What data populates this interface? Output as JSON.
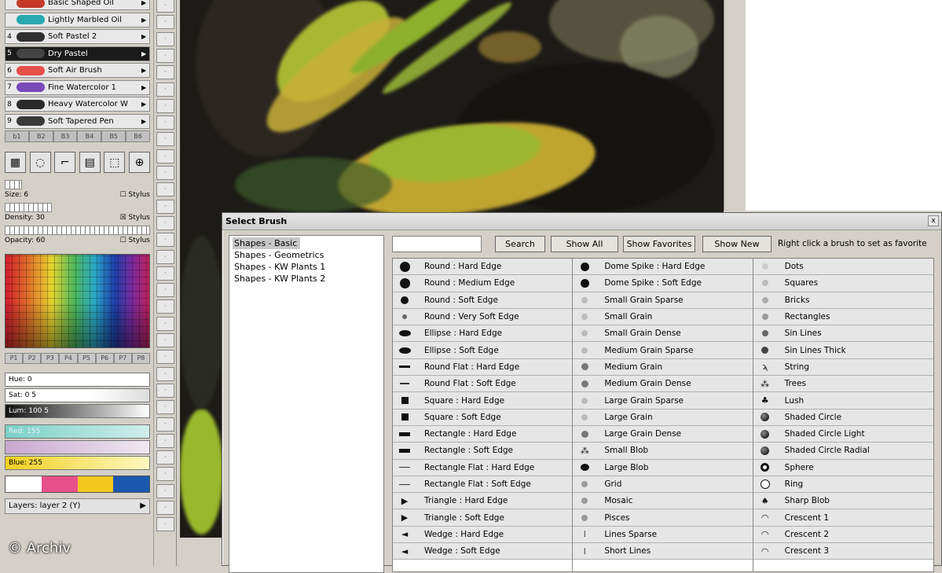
{
  "presets": [
    {
      "num": "",
      "name": "Basic Shaped Oil",
      "color": "#c63a2a"
    },
    {
      "num": "",
      "name": "Lightly Marbled Oil",
      "color": "#2aa8b0"
    },
    {
      "num": "4",
      "name": "Soft Pastel 2",
      "color": "#303030"
    },
    {
      "num": "5",
      "name": "Dry Pastel",
      "color": "#444444",
      "selected": true
    },
    {
      "num": "6",
      "name": "Soft Air Brush",
      "color": "#e8504a"
    },
    {
      "num": "7",
      "name": "Fine Watercolor 1",
      "color": "#7a4ab8"
    },
    {
      "num": "8",
      "name": "Heavy Watercolor W",
      "color": "#2a2a2a"
    },
    {
      "num": "9",
      "name": "Soft Tapered Pen",
      "color": "#3a3a3a"
    }
  ],
  "preset_tabs": [
    "b1",
    "B2",
    "B3",
    "B4",
    "B5",
    "B6"
  ],
  "sliders": [
    {
      "label": "Size: 6",
      "option": "Stylus"
    },
    {
      "label": "Density: 30",
      "option": "Stylus"
    },
    {
      "label": "Opacity: 60",
      "option": "Stylus"
    }
  ],
  "swatch_tabs": [
    "P1",
    "P2",
    "P3",
    "P4",
    "P5",
    "P6",
    "P7",
    "P8"
  ],
  "hsv": {
    "hue": "Hue: 0",
    "sat": "Sat: 0 5",
    "lum": "Lum: 100 5",
    "red": "Red: 155",
    "blue": "Blue: 255"
  },
  "palette": [
    "#ffffff",
    "#e8508a",
    "#f2c820",
    "#1a58b0"
  ],
  "layers_label": "Layers: layer 2 (Y)",
  "copyright": "© Archiv",
  "dialog": {
    "title": "Select Brush",
    "close": "x",
    "categories": [
      "Shapes - Basic",
      "Shapes - Geometrics",
      "Shapes - KW Plants 1",
      "Shapes - KW Plants 2"
    ],
    "search_value": "",
    "buttons": {
      "search": "Search",
      "show_all": "Show All",
      "show_favorites": "Show Favorites",
      "show_new": "Show New"
    },
    "hint": "Right click a brush to set as favorite"
  },
  "brushes": {
    "col1": [
      "Round : Hard Edge",
      "Round : Medium Edge",
      "Round : Soft Edge",
      "Round : Very Soft Edge",
      "Ellipse : Hard Edge",
      "Ellipse : Soft Edge",
      "Round Flat : Hard Edge",
      "Round Flat : Soft Edge",
      "Square : Hard Edge",
      "Square : Soft Edge",
      "Rectangle : Hard Edge",
      "Rectangle : Soft Edge",
      "Rectangle Flat : Hard Edge",
      "Rectangle Flat : Soft Edge",
      "Triangle : Hard Edge",
      "Triangle : Soft Edge",
      "Wedge : Hard Edge",
      "Wedge : Soft Edge"
    ],
    "col2": [
      "Dome Spike : Hard Edge",
      "Dome Spike : Soft Edge",
      "Small Grain Sparse",
      "Small Grain",
      "Small Grain Dense",
      "Medium Grain Sparse",
      "Medium Grain",
      "Medium Grain Dense",
      "Large Grain Sparse",
      "Large Grain",
      "Large Grain Dense",
      "Small Blob",
      "Large Blob",
      "Grid",
      "Mosaic",
      "Pisces",
      "Lines Sparse",
      "Short Lines"
    ],
    "col3": [
      "Dots",
      "Squares",
      "Bricks",
      "Rectangles",
      "Sin Lines",
      "Sin Lines Thick",
      "String",
      "Trees",
      "Lush",
      "Shaded Circle",
      "Shaded Circle Light",
      "Shaded Circle Radial",
      "Sphere",
      "Ring",
      "Sharp Blob",
      "Crescent 1",
      "Crescent 2",
      "Crescent 3"
    ]
  },
  "icons": {
    "col1": [
      "dot-l",
      "dot-l",
      "dot-m",
      "dot-s",
      "ell",
      "ell",
      "dash",
      "dash-t",
      "sq",
      "sq",
      "rect",
      "rect",
      "line",
      "line",
      "tri",
      "tri",
      "wedge",
      "wedge"
    ],
    "col2": [
      "spike",
      "spike",
      "grain",
      "grain",
      "grain",
      "grain",
      "grain-d",
      "grain-d",
      "grain",
      "grain",
      "grain-d",
      "blob-s",
      "blob-l",
      "grid",
      "grid",
      "grid",
      "lines",
      "lines"
    ],
    "col3": [
      "dots",
      "squares",
      "bricks",
      "rects",
      "sin",
      "sin-t",
      "string",
      "trees",
      "lush",
      "shaded",
      "shaded",
      "shaded",
      "sphere",
      "ring",
      "blob",
      "crescent",
      "crescent",
      "crescent"
    ]
  }
}
